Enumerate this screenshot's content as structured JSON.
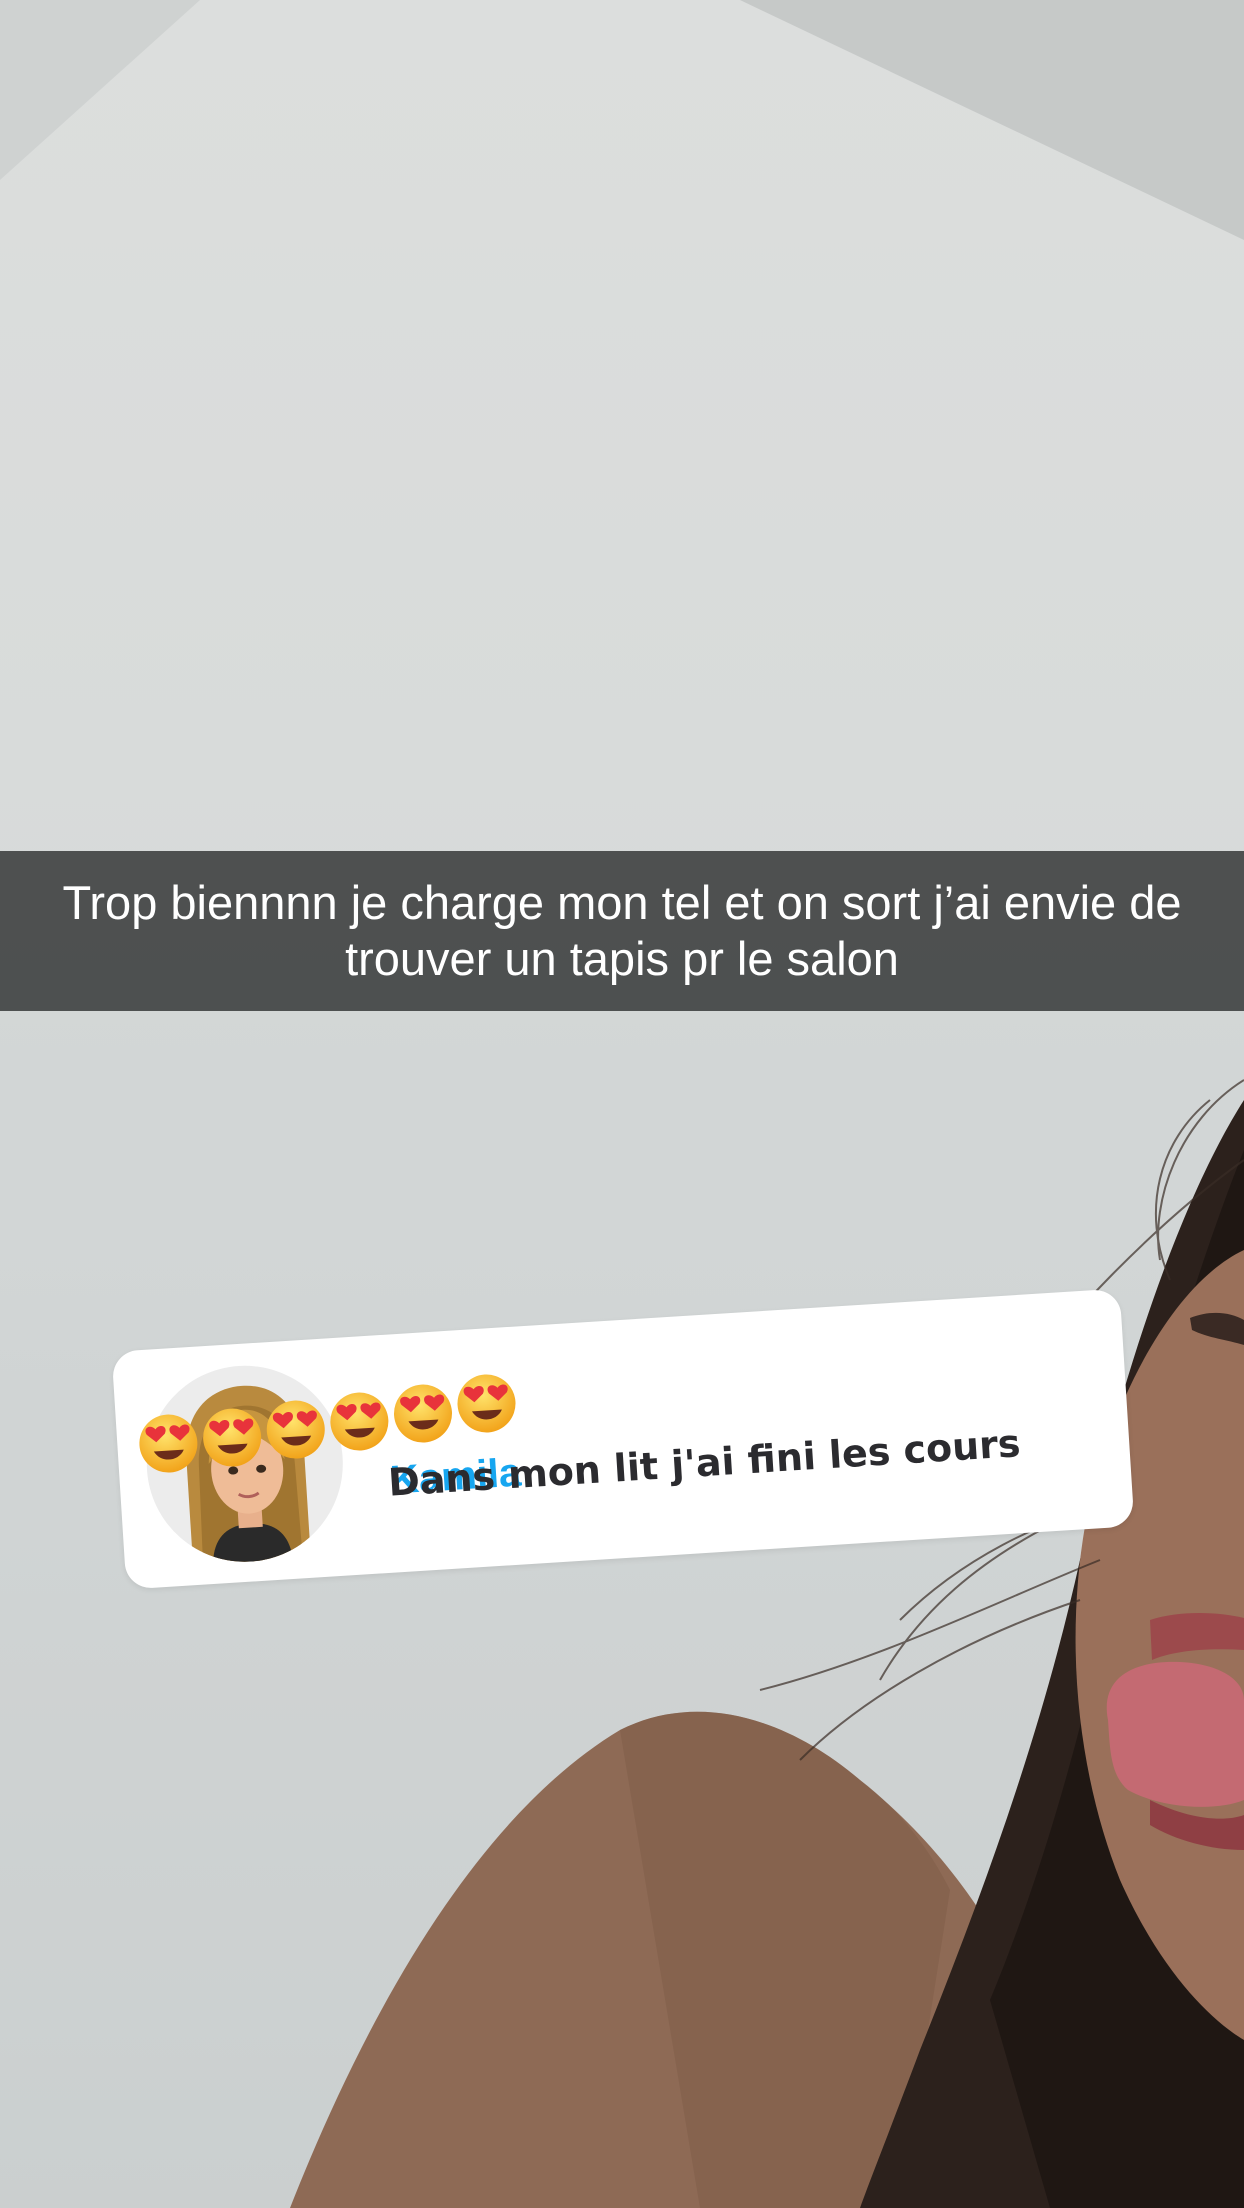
{
  "story": {
    "caption": "Trop biennnn je charge mon tel et on sort j’ai envie de trouver un tapis pr le salon"
  },
  "reply_sticker": {
    "sender_name": "Kamila",
    "reaction_emoji": "😍",
    "reaction_count": 6,
    "message": "Dans mon lit j'ai fini les cours",
    "avatar_icon": "bitmoji-avatar-icon"
  },
  "colors": {
    "sender_name": "#17a6f0",
    "caption_bar": "#373939",
    "message_text": "#2b2b2f"
  }
}
